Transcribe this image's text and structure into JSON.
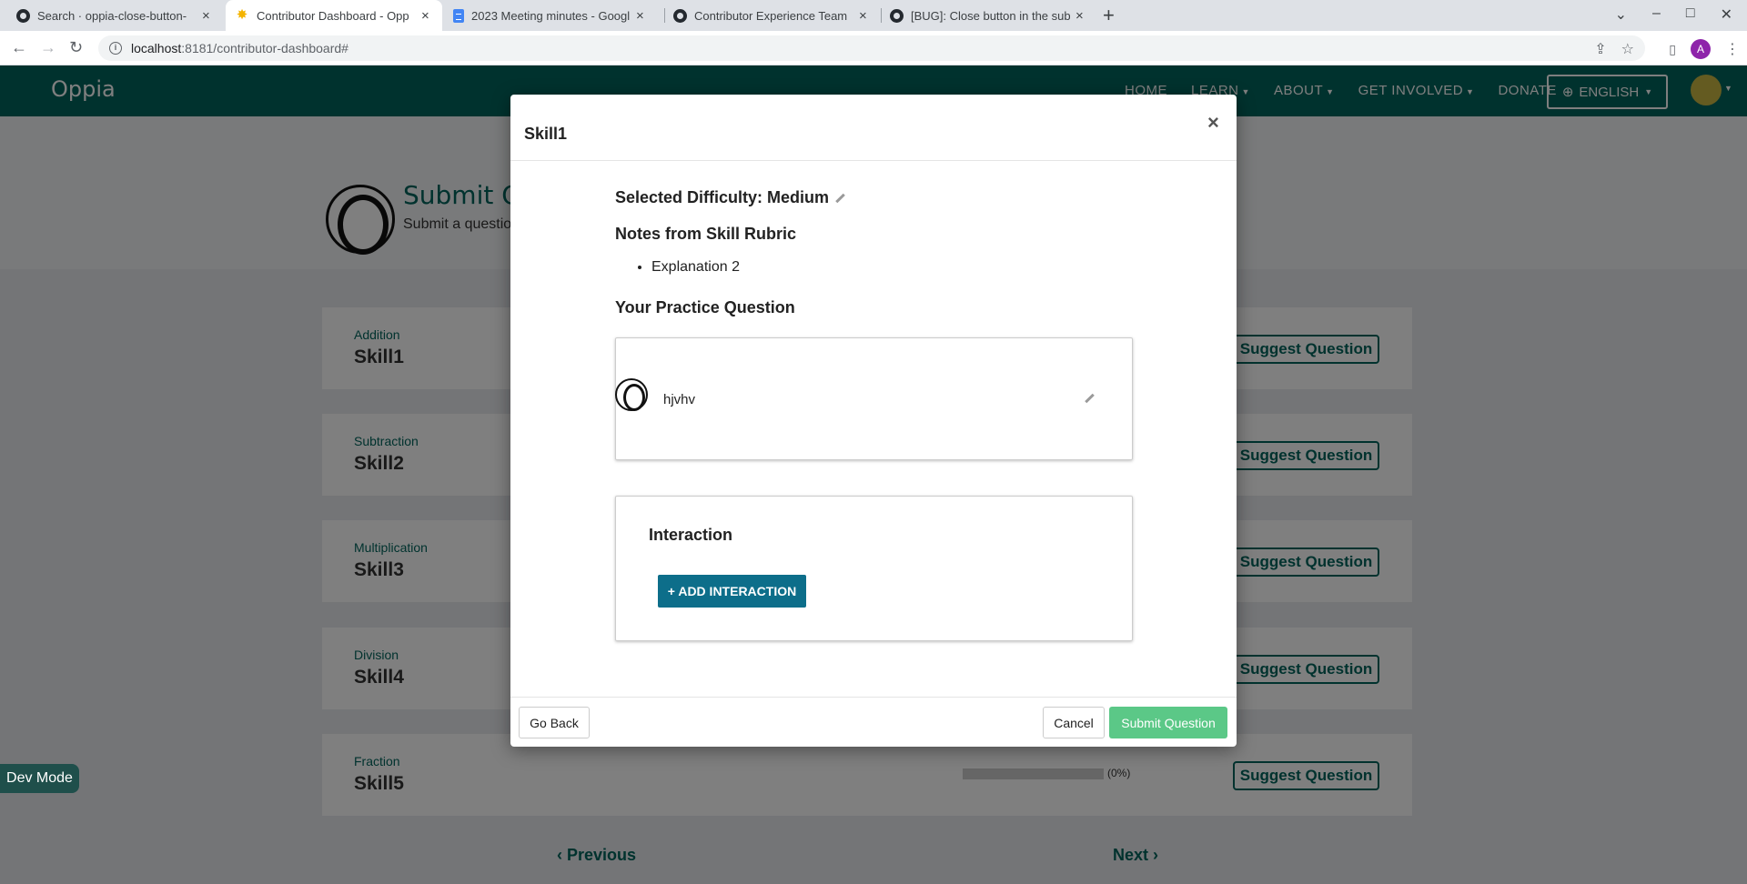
{
  "browser": {
    "tabs": [
      {
        "title": "Search · oppia-close-button-",
        "icon": "github-icon"
      },
      {
        "title": "Contributor Dashboard - Opp",
        "icon": "oppia-favicon"
      },
      {
        "title": "2023 Meeting minutes - Googl",
        "icon": "google-docs-icon"
      },
      {
        "title": "Contributor Experience Team",
        "icon": "github-icon"
      },
      {
        "title": "[BUG]: Close button in the sub",
        "icon": "github-icon"
      }
    ],
    "url_host": "localhost",
    "url_path": ":8181/contributor-dashboard#",
    "profile_initial": "A"
  },
  "navbar": {
    "logo": "Oppia",
    "links": [
      "HOME",
      "LEARN",
      "ABOUT",
      "GET INVOLVED",
      "DONATE"
    ],
    "language": "ENGLISH"
  },
  "hero": {
    "title": "Submit Q",
    "subtitle": "Submit a questio"
  },
  "skills": [
    {
      "topic": "Addition",
      "name": "Skill1",
      "button": "Suggest Question"
    },
    {
      "topic": "Subtraction",
      "name": "Skill2",
      "button": "Suggest Question"
    },
    {
      "topic": "Multiplication",
      "name": "Skill3",
      "button": "Suggest Question"
    },
    {
      "topic": "Division",
      "name": "Skill4",
      "button": "Suggest Question"
    },
    {
      "topic": "Fraction",
      "name": "Skill5",
      "button": "Suggest Question",
      "progress_label": "(0%)",
      "progress": 0
    }
  ],
  "pager": {
    "previous": "Previous",
    "next": "Next"
  },
  "dev_mode": "Dev Mode",
  "modal": {
    "title": "Skill1",
    "difficulty_label": "Selected Difficulty: Medium",
    "notes_heading": "Notes from Skill Rubric",
    "notes": [
      "Explanation 2"
    ],
    "practice_heading": "Your Practice Question",
    "question_text": "hjvhv",
    "interaction_heading": "Interaction",
    "add_interaction": "+ ADD INTERACTION",
    "go_back": "Go Back",
    "cancel": "Cancel",
    "submit": "Submit Question"
  }
}
